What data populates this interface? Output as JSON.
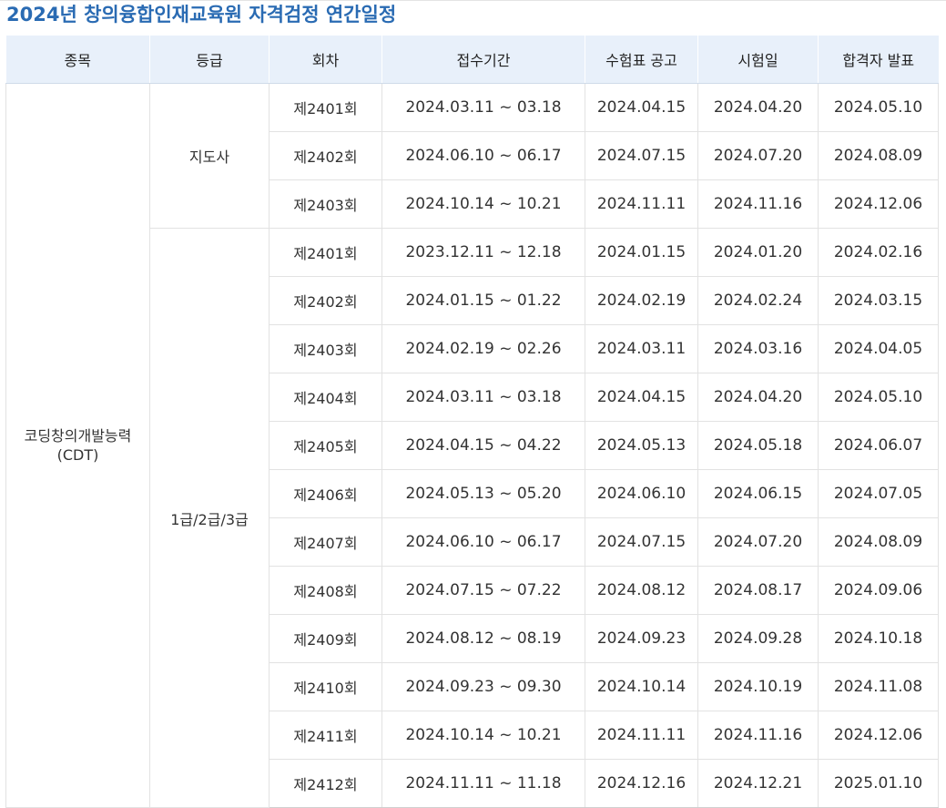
{
  "title": "2024년 창의융합인재교육원 자격검정 연간일정",
  "headers": {
    "subject": "종목",
    "grade": "등급",
    "round": "회차",
    "period": "접수기간",
    "ticket": "수험표 공고",
    "exam": "시험일",
    "result": "합격자 발표"
  },
  "subject": {
    "line1": "코딩창의개발능력",
    "line2": "(CDT)"
  },
  "groups": [
    {
      "grade": "지도사",
      "rows": [
        {
          "round": "제2401회",
          "period": "2024.03.11 ~ 03.18",
          "ticket": "2024.04.15",
          "exam": "2024.04.20",
          "result": "2024.05.10"
        },
        {
          "round": "제2402회",
          "period": "2024.06.10 ~ 06.17",
          "ticket": "2024.07.15",
          "exam": "2024.07.20",
          "result": "2024.08.09"
        },
        {
          "round": "제2403회",
          "period": "2024.10.14 ~ 10.21",
          "ticket": "2024.11.11",
          "exam": "2024.11.16",
          "result": "2024.12.06"
        }
      ]
    },
    {
      "grade": "1급/2급/3급",
      "rows": [
        {
          "round": "제2401회",
          "period": "2023.12.11 ~ 12.18",
          "ticket": "2024.01.15",
          "exam": "2024.01.20",
          "result": "2024.02.16"
        },
        {
          "round": "제2402회",
          "period": "2024.01.15 ~ 01.22",
          "ticket": "2024.02.19",
          "exam": "2024.02.24",
          "result": "2024.03.15"
        },
        {
          "round": "제2403회",
          "period": "2024.02.19 ~ 02.26",
          "ticket": "2024.03.11",
          "exam": "2024.03.16",
          "result": "2024.04.05"
        },
        {
          "round": "제2404회",
          "period": "2024.03.11 ~ 03.18",
          "ticket": "2024.04.15",
          "exam": "2024.04.20",
          "result": "2024.05.10"
        },
        {
          "round": "제2405회",
          "period": "2024.04.15 ~ 04.22",
          "ticket": "2024.05.13",
          "exam": "2024.05.18",
          "result": "2024.06.07"
        },
        {
          "round": "제2406회",
          "period": "2024.05.13 ~ 05.20",
          "ticket": "2024.06.10",
          "exam": "2024.06.15",
          "result": "2024.07.05"
        },
        {
          "round": "제2407회",
          "period": "2024.06.10 ~ 06.17",
          "ticket": "2024.07.15",
          "exam": "2024.07.20",
          "result": "2024.08.09"
        },
        {
          "round": "제2408회",
          "period": "2024.07.15 ~ 07.22",
          "ticket": "2024.08.12",
          "exam": "2024.08.17",
          "result": "2024.09.06"
        },
        {
          "round": "제2409회",
          "period": "2024.08.12 ~ 08.19",
          "ticket": "2024.09.23",
          "exam": "2024.09.28",
          "result": "2024.10.18"
        },
        {
          "round": "제2410회",
          "period": "2024.09.23 ~ 09.30",
          "ticket": "2024.10.14",
          "exam": "2024.10.19",
          "result": "2024.11.08"
        },
        {
          "round": "제2411회",
          "period": "2024.10.14 ~ 10.21",
          "ticket": "2024.11.11",
          "exam": "2024.11.16",
          "result": "2024.12.06"
        },
        {
          "round": "제2412회",
          "period": "2024.11.11 ~ 11.18",
          "ticket": "2024.12.16",
          "exam": "2024.12.21",
          "result": "2025.01.10"
        }
      ]
    }
  ],
  "colors": {
    "title": "#2a6bb3",
    "header_bg": "#e8f0fa",
    "border": "#e2e2e2",
    "text": "#333333"
  }
}
